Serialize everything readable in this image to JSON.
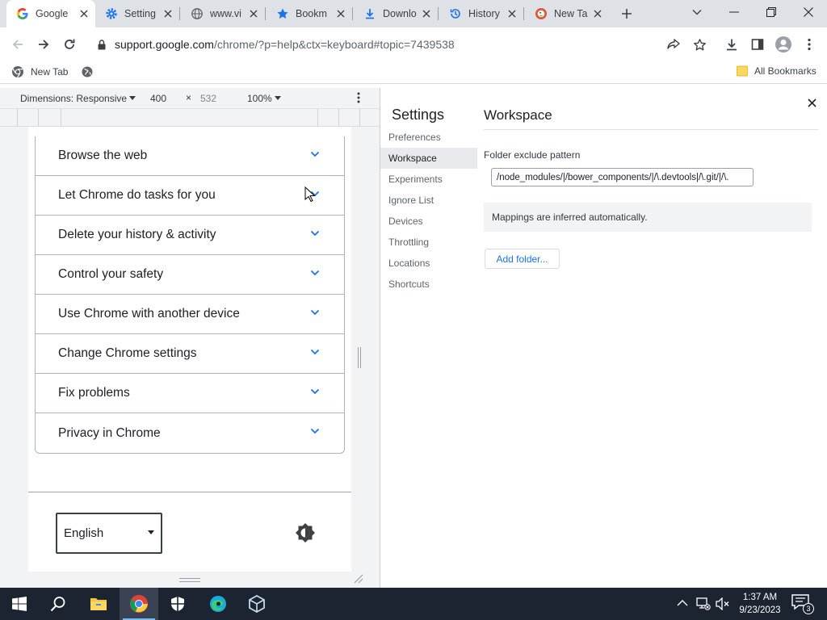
{
  "tabs": [
    {
      "title": "Google",
      "icon": "google-g-icon",
      "active": true
    },
    {
      "title": "Setting",
      "icon": "gear-icon",
      "active": false
    },
    {
      "title": "www.vi",
      "icon": "globe-icon",
      "active": false
    },
    {
      "title": "Bookm",
      "icon": "star-icon",
      "active": false
    },
    {
      "title": "Downlo",
      "icon": "download-icon",
      "active": false
    },
    {
      "title": "History",
      "icon": "history-icon",
      "active": false
    },
    {
      "title": "New Ta",
      "icon": "duckduckgo-icon",
      "active": false
    }
  ],
  "address": {
    "host": "support.google.com",
    "path": "/chrome/?p=help&ctx=keyboard#topic=7439538"
  },
  "bookmarks": {
    "new_tab": "New Tab",
    "all_bookmarks": "All Bookmarks"
  },
  "emulation": {
    "dimensions_label": "Dimensions: Responsive",
    "width": "400",
    "times": "×",
    "height": "532",
    "zoom": "100%"
  },
  "help_page": {
    "sections": [
      "Browse the web",
      "Let Chrome do tasks for you",
      "Delete your history & activity",
      "Control your safety",
      "Use Chrome with another device",
      "Change Chrome settings",
      "Fix problems",
      "Privacy in Chrome"
    ],
    "language": "English"
  },
  "devtools": {
    "settings_title": "Settings",
    "nav": [
      "Preferences",
      "Workspace",
      "Experiments",
      "Ignore List",
      "Devices",
      "Throttling",
      "Locations",
      "Shortcuts"
    ],
    "active_nav": "Workspace",
    "panel_title": "Workspace",
    "folder_exclude_label": "Folder exclude pattern",
    "folder_exclude_value": "/node_modules/|/bower_components/|/\\.devtools|/\\.git/|/\\.",
    "mappings_text": "Mappings are inferred automatically.",
    "add_folder_label": "Add folder..."
  },
  "taskbar": {
    "time": "1:37 AM",
    "date": "9/23/2023",
    "notification_count": "3",
    "accent_color": "#76b9ed"
  }
}
